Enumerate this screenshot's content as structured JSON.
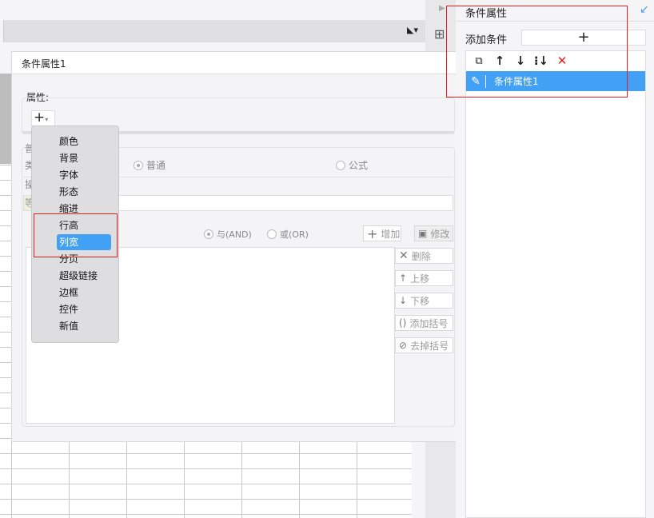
{
  "dialog": {
    "title": "条件属性1",
    "attr_label": "属性:",
    "partial_labels": [
      "普",
      "类",
      "操",
      "等"
    ],
    "type_options": [
      {
        "label": "普通",
        "selected": true
      },
      {
        "label": "公式",
        "selected": false
      }
    ],
    "logic_options": [
      {
        "label": "与(AND)",
        "selected": true
      },
      {
        "label": "或(OR)",
        "selected": false
      }
    ],
    "buttons": {
      "add": "增加",
      "modify": "修改",
      "delete": "删除",
      "move_up": "上移",
      "move_down": "下移",
      "add_paren": "添加括号",
      "remove_paren": "去掉括号"
    }
  },
  "menu": {
    "items": [
      "颜色",
      "背景",
      "字体",
      "形态",
      "缩进",
      "行高",
      "列宽",
      "分页",
      "超级链接",
      "边框",
      "控件",
      "新值"
    ],
    "selected": "列宽"
  },
  "right_panel": {
    "title": "条件属性",
    "add_label": "添加条件",
    "list": [
      {
        "label": "条件属性1",
        "selected": true
      }
    ]
  },
  "colors": {
    "accent": "#42a0f5",
    "highlight": "#e02020"
  }
}
